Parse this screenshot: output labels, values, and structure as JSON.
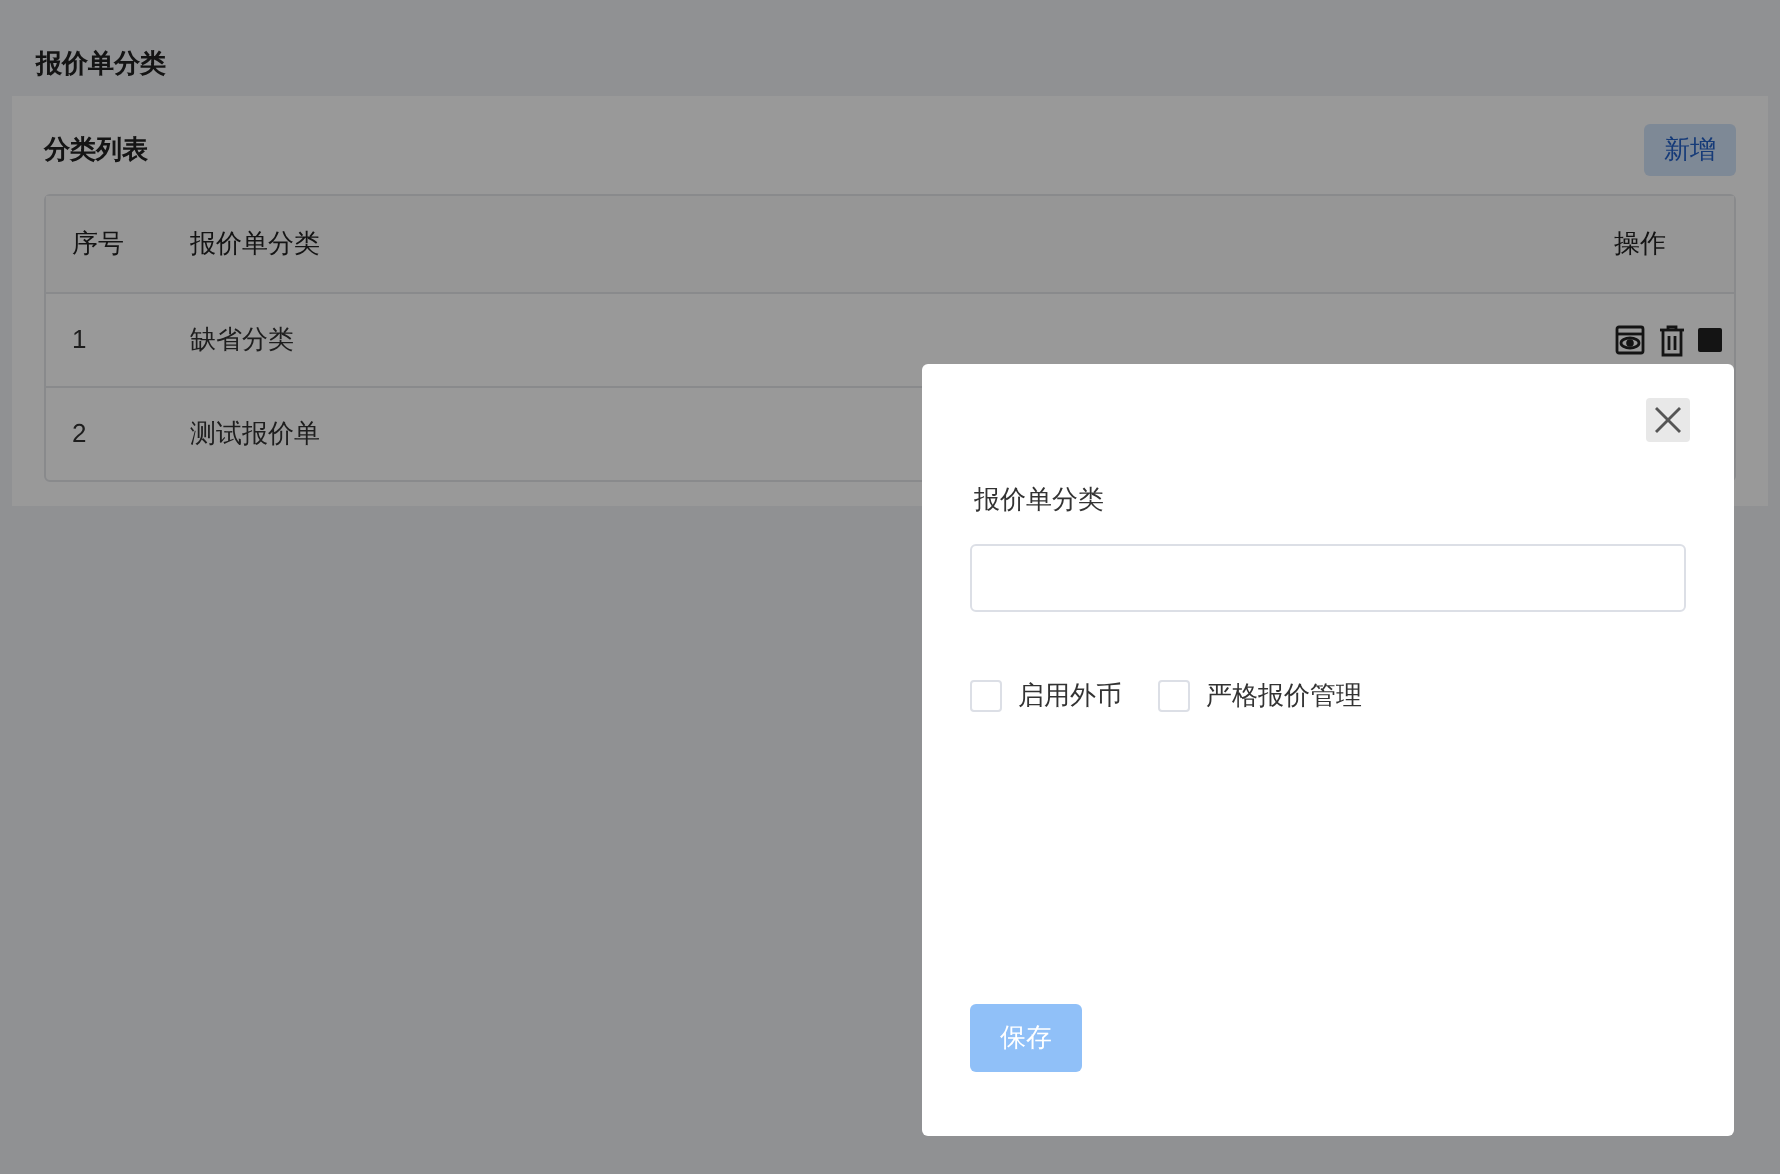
{
  "page_title": "报价单分类",
  "card": {
    "title": "分类列表",
    "add_button": "新增"
  },
  "table": {
    "columns": [
      "序号",
      "报价单分类",
      "操作"
    ],
    "rows": [
      {
        "index": "1",
        "name": "缺省分类",
        "has_actions": true
      },
      {
        "index": "2",
        "name": "测试报价单"
      }
    ]
  },
  "dialog": {
    "field_label": "报价单分类",
    "checkboxes": [
      {
        "label": "启用外币",
        "checked": false
      },
      {
        "label": "严格报价管理",
        "checked": false
      }
    ],
    "save_button": {
      "label": "保存",
      "disabled": true
    }
  }
}
